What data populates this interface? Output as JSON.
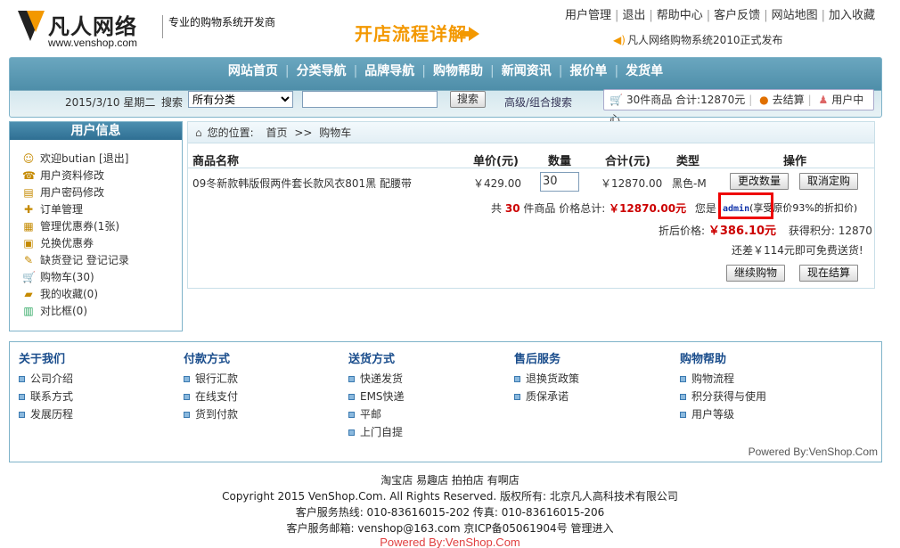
{
  "header": {
    "logo_name": "凡人网络",
    "logo_url": "www.venshop.com",
    "slogan": "专业的购物系统开发商",
    "promo": "开店流程详解",
    "toplinks": [
      "用户管理",
      "退出",
      "帮助中心",
      "客户反馈",
      "网站地图",
      "加入收藏"
    ],
    "notice": "凡人网络购物系统2010正式发布"
  },
  "nav": {
    "menu": [
      "网站首页",
      "分类导航",
      "品牌导航",
      "购物帮助",
      "新闻资讯",
      "报价单",
      "发货单"
    ],
    "date": "2015/3/10 星期二",
    "search_label": "搜索",
    "category_selected": "所有分类",
    "search_value": "",
    "search_button": "搜索",
    "advanced": "高级/组合搜索",
    "cart_summary": "30件商品 合计:12870元",
    "checkout": "去结算",
    "user_center": "用户中心"
  },
  "sidebar": {
    "title": "用户信息",
    "items": [
      "欢迎butian [退出]",
      "用户资料修改",
      "用户密码修改",
      "订单管理",
      "管理优惠券(1张)",
      "兑换优惠券",
      "缺货登记 登记记录",
      "购物车(30)",
      "我的收藏(0)",
      "对比框(0)"
    ]
  },
  "cart": {
    "crumb_label": "您的位置:",
    "crumb_home": "首页",
    "crumb_sep": ">>",
    "crumb_current": "购物车",
    "headers": {
      "name": "商品名称",
      "price": "单价(元)",
      "qty": "数量",
      "total": "合计(元)",
      "type": "类型",
      "op": "操作"
    },
    "item": {
      "name": "09冬新款韩版假两件套长款风衣801黑 配腰带",
      "price": "￥429.00",
      "qty": "30",
      "total": "￥12870.00",
      "type": "黑色-M"
    },
    "btn_update": "更改数量",
    "btn_cancel": "取消定购",
    "summary_pre": "共",
    "summary_count": "30",
    "summary_mid": "件商品 价格总计:",
    "summary_total": "￥12870.00元",
    "you_are": "您是",
    "user_level": "admin",
    "discount_note": "(享受原价93%的折扣价)",
    "discount_label": "折后价格:",
    "discount_price": "￥386.10元",
    "points_label": "获得积分:",
    "points": "12870",
    "free_shipping": "还差￥114元即可免费送货!",
    "btn_continue": "继续购物",
    "btn_checkout": "现在结算"
  },
  "info": {
    "columns": [
      {
        "title": "关于我们",
        "items": [
          "公司介绍",
          "联系方式",
          "发展历程"
        ]
      },
      {
        "title": "付款方式",
        "items": [
          "银行汇款",
          "在线支付",
          "货到付款"
        ]
      },
      {
        "title": "送货方式",
        "items": [
          "快递发货",
          "EMS快递",
          "平邮",
          "上门自提"
        ]
      },
      {
        "title": "售后服务",
        "items": [
          "退换货政策",
          "质保承诺"
        ]
      },
      {
        "title": "购物帮助",
        "items": [
          "购物流程",
          "积分获得与使用",
          "用户等级"
        ]
      }
    ],
    "powered": "Powered By:VenShop.Com"
  },
  "footer": {
    "line1": "淘宝店 易趣店 拍拍店 有啊店",
    "line2": "Copyright 2015 VenShop.Com. All Rights Reserved. 版权所有: 北京凡人高科技术有限公司",
    "line3": "客户服务热线: 010-83616015-202 传真: 010-83616015-206",
    "line4": "客户服务邮箱: venshop@163.com 京ICP备05061904号 管理进入",
    "line5": "Powered By:VenShop.Com"
  }
}
